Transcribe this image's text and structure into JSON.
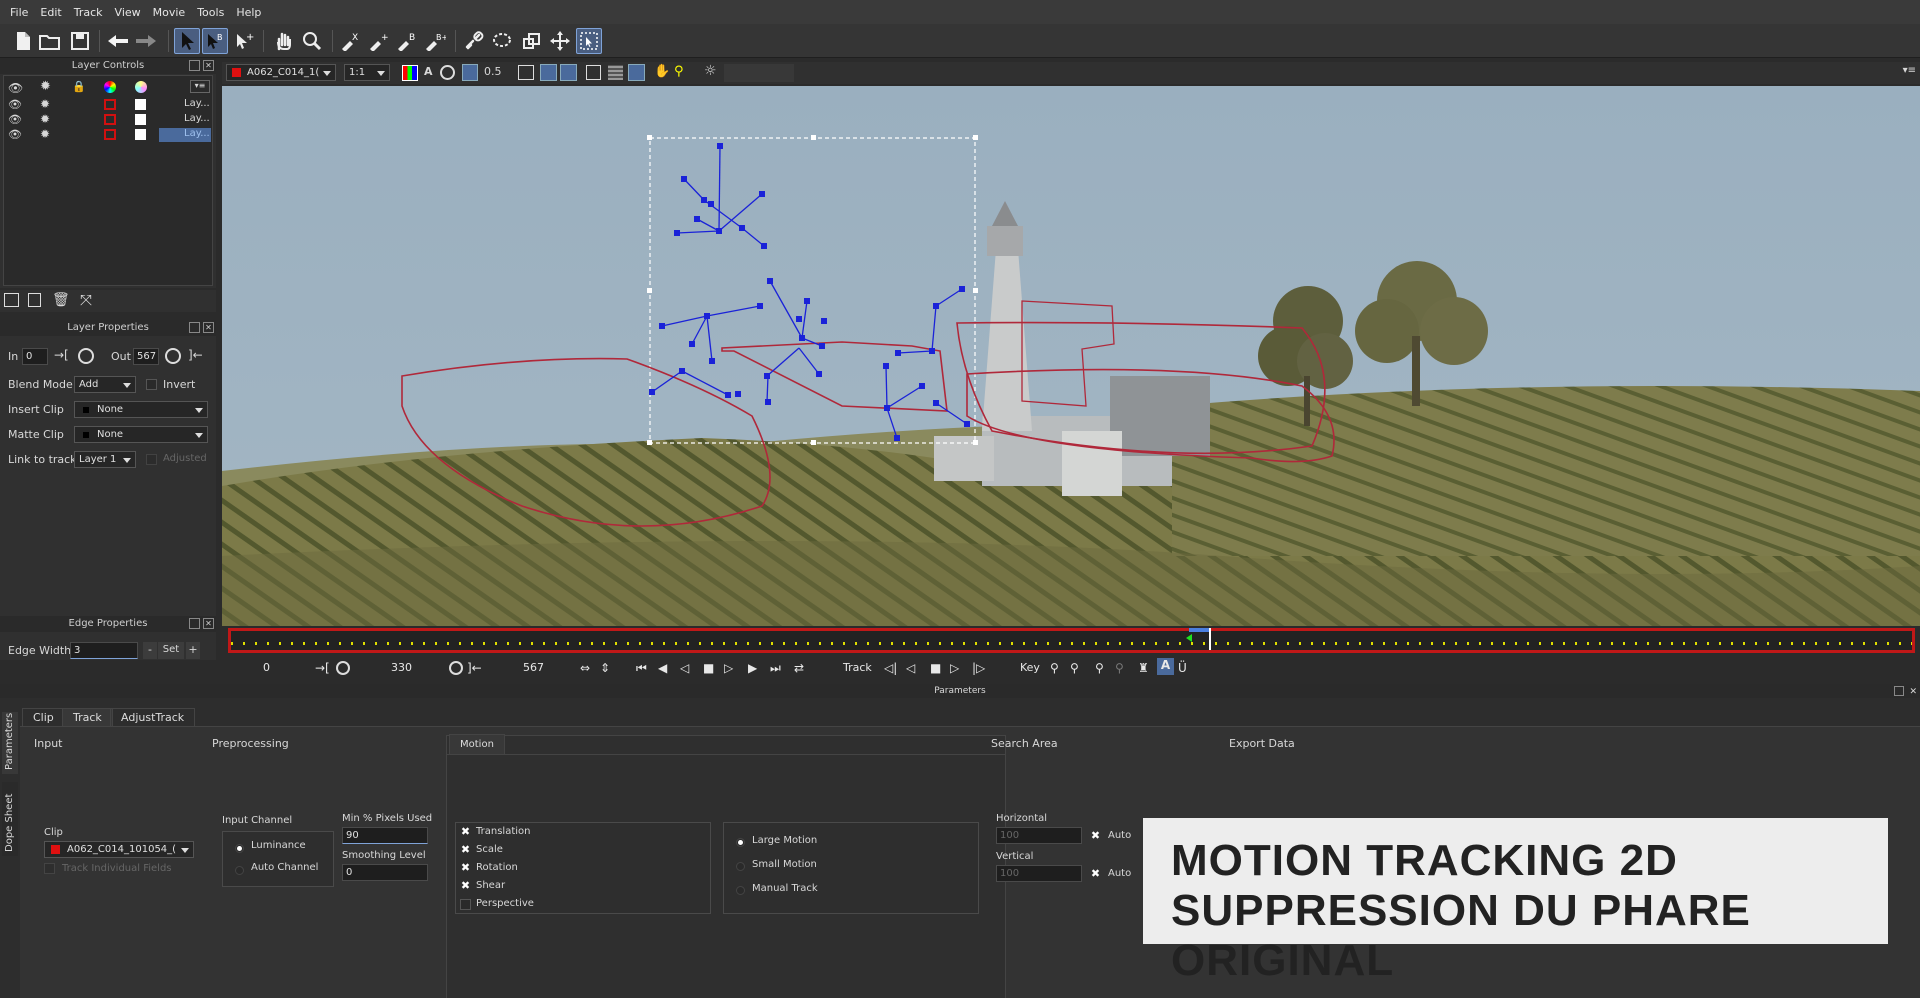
{
  "menu": [
    "File",
    "Edit",
    "Track",
    "View",
    "Movie",
    "Tools",
    "Help"
  ],
  "viewer_bar": {
    "clip": "A062_C014_1(",
    "zoom": "1:1",
    "opacity": "0.5"
  },
  "layer_controls": {
    "title": "Layer Controls",
    "layers": [
      {
        "name": "Lay...",
        "selected": false
      },
      {
        "name": "Lay...",
        "selected": false
      },
      {
        "name": "Lay...",
        "selected": true
      }
    ]
  },
  "layer_properties": {
    "title": "Layer Properties",
    "in_label": "In",
    "in_value": "0",
    "out_label": "Out",
    "out_value": "567",
    "blend_mode_label": "Blend Mode",
    "blend_mode": "Add",
    "invert_label": "Invert",
    "insert_clip_label": "Insert Clip",
    "insert_clip": "None",
    "matte_clip_label": "Matte Clip",
    "matte_clip": "None",
    "link_label": "Link to track",
    "link_value": "Layer 1",
    "adjusted_label": "Adjusted"
  },
  "edge_properties": {
    "title": "Edge Properties",
    "width_label": "Edge Width",
    "width_value": "3",
    "minus": "-",
    "set": "Set",
    "plus": "+"
  },
  "transport": {
    "start": "0",
    "mid": "330",
    "end": "567",
    "track_label": "Track",
    "key_label": "Key"
  },
  "parameters": {
    "title": "Parameters",
    "tabs": [
      "Clip",
      "Track",
      "AdjustTrack"
    ],
    "side_tabs": [
      "Parameters",
      "Dope Sheet"
    ],
    "input": {
      "heading": "Input",
      "clip_label": "Clip",
      "clip_value": "A062_C014_101054_(",
      "track_fields": "Track Individual Fields"
    },
    "preprocessing": {
      "heading": "Preprocessing",
      "input_channel_label": "Input Channel",
      "luminance": "Luminance",
      "auto_channel": "Auto Channel",
      "min_pixels_label": "Min % Pixels Used",
      "min_pixels_value": "90",
      "smoothing_label": "Smoothing Level",
      "smoothing_value": "0"
    },
    "motion": {
      "tab": "Motion",
      "options": [
        {
          "label": "Translation",
          "checked": true
        },
        {
          "label": "Scale",
          "checked": true
        },
        {
          "label": "Rotation",
          "checked": true
        },
        {
          "label": "Shear",
          "checked": true
        },
        {
          "label": "Perspective",
          "checked": false
        }
      ],
      "modes": [
        {
          "label": "Large Motion",
          "selected": true
        },
        {
          "label": "Small Motion",
          "selected": false
        },
        {
          "label": "Manual Track",
          "selected": false
        }
      ]
    },
    "search_area": {
      "heading": "Search Area",
      "horizontal_label": "Horizontal",
      "horizontal_value": "100",
      "vertical_label": "Vertical",
      "vertical_value": "100",
      "auto_label": "Auto"
    },
    "export_data": {
      "heading": "Export Data"
    }
  },
  "overlay": {
    "line1": "MOTION TRACKING 2D",
    "line2": "SUPPRESSION DU PHARE ORIGINAL"
  },
  "colors": {
    "accent": "#4a6a9c",
    "timeline_border": "#c01818",
    "spline": "#b0283a",
    "tracker": "#1a22d8"
  }
}
